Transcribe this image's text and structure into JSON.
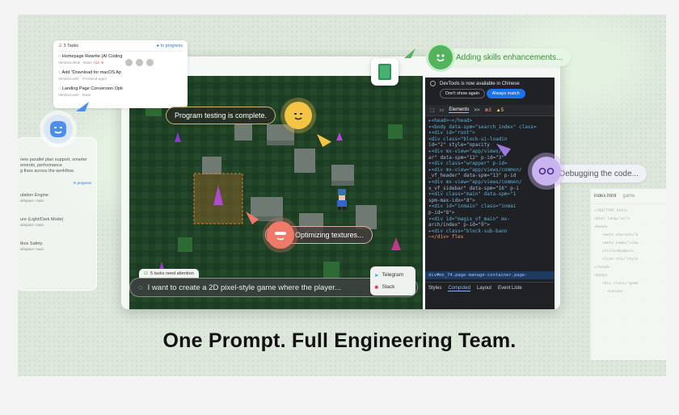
{
  "headline": "One Prompt. Full Engineering Team.",
  "tasks_panel": {
    "count_label": "3 Tasks",
    "status": "In progress",
    "items": [
      {
        "title": "Homepage Rewrite (AI Coding",
        "sub": "Verdent-desk · Base",
        "delta": "+12 -6"
      },
      {
        "title": "Add \"Download for macOS Ap",
        "sub": "Verdent-web · Frontend-agen"
      },
      {
        "title": "Landing Page Conversion Opti",
        "sub": "Verdent-web · Base"
      }
    ]
  },
  "left_ghost": {
    "lines": [
      "new parallel plan support, smarter",
      "ements, performance",
      "g fixes across the workflow."
    ],
    "status": "In progress",
    "items": [
      {
        "title": "ulation Engine",
        "sub": "al/space: main"
      },
      {
        "title": "ure (Light/Dark Mode)",
        "sub": "al/space: main"
      },
      {
        "title": "tbox Safety",
        "sub": "al/space: main"
      }
    ]
  },
  "bubbles": {
    "adding": "Adding skills enhancements...",
    "testing": "Program testing is complete.",
    "optimizing": "Optimizing textures...",
    "debugging": "Debugging the code..."
  },
  "devtools": {
    "banner": "DevTools is now available in Chinese",
    "btn_dismiss": "Don't show again",
    "btn_switch": "Always match",
    "tab_elements": "Elements",
    "more": ">>",
    "errors": "3",
    "warnings": "5",
    "dom_lines": [
      "▸<head>⋯</head>",
      "▾<body data-spm=\"search_index\" class=",
      "  ▾<div id=\"root\">",
      "    <div class=\"block-ui-loadin",
      "    id=\"2\" style=\"opacity",
      "    ▸<div mx-view=\"app/views/co",
      "    ar\" data-spm=\"12\" p-id=\"3\"",
      "    ▾<div class=\"wrapper\" p-id=",
      "      ▸<div mx-view=\"app/views/common/",
      "      _vf_header\" data-spm=\"13\" p-id",
      "      ▸<div mx-view=\"app/views/common/",
      "      x_vf_sidebar\" data-spm=\"16\" p-i",
      "      ▾<div class=\"main\" data-spm=\"1",
      "      spm-max-idx=\"8\">",
      "        ▾<div id=\"inmain\" class=\"inmai",
      "        p-id=\"8\">",
      "          ▾<div id=\"magix_vf_main\" mx-",
      "          arch/index\" p-id=\"9\">",
      "            ▸<div class=\"block-sub-bann",
      "            ⋯</div> flex"
    ],
    "path": "div#mx_74.page-manage-container.page-",
    "bottom_tabs": [
      "Styles",
      "Computed",
      "Layout",
      "Event Liste"
    ]
  },
  "code_panel": {
    "tab1": "index.html",
    "tab2": "game",
    "lines": [
      "<!DOCTYPE html>",
      "<html lang=\"en\">",
      "<head>",
      "<meta charset=\"U",
      "<meta name=\"view",
      "<title>Bomberu",
      "<link rel=\"style",
      "</head>",
      "<body>",
      "<div class=\"game",
      "<canvas"
    ]
  },
  "prompt": {
    "attention": "5 tasks need attention",
    "text": "I want to create a 2D pixel-style game where the player..."
  },
  "channels": [
    "Telegram",
    "Slack"
  ],
  "colors": {
    "accent_green": "#3a8f3a",
    "devtools_blue": "#1a73e8",
    "error": "#f28b82"
  }
}
